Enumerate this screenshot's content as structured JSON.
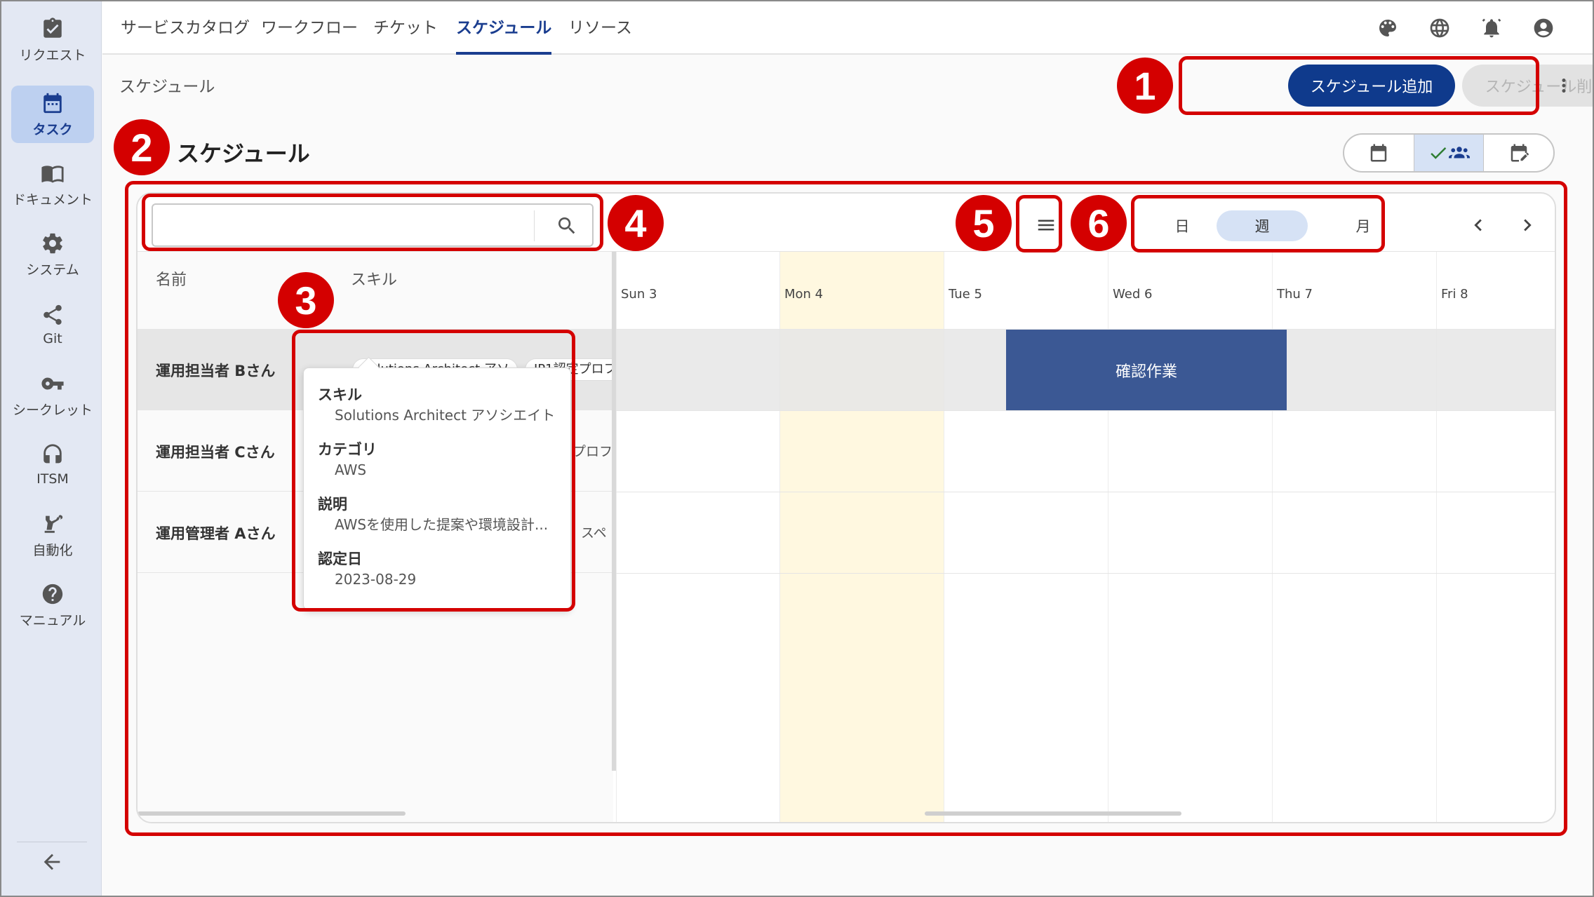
{
  "sidebar": {
    "items": [
      {
        "label": "リクエスト",
        "icon": "clipboard-check-icon"
      },
      {
        "label": "タスク",
        "icon": "calendar-icon"
      },
      {
        "label": "ドキュメント",
        "icon": "book-icon"
      },
      {
        "label": "システム",
        "icon": "gear-icon"
      },
      {
        "label": "Git",
        "icon": "share-icon"
      },
      {
        "label": "シークレット",
        "icon": "key-icon"
      },
      {
        "label": "ITSM",
        "icon": "headset-icon"
      },
      {
        "label": "自動化",
        "icon": "robot-arm-icon"
      },
      {
        "label": "マニュアル",
        "icon": "help-icon"
      }
    ],
    "active_index": 1,
    "collapse_icon": "arrow-left-icon"
  },
  "topnav": {
    "tabs": [
      "サービスカタログ",
      "ワークフロー",
      "チケット",
      "スケジュール",
      "リソース"
    ],
    "active_tab": "スケジュール",
    "icons": [
      "palette-icon",
      "globe-icon",
      "bell-icon",
      "account-icon"
    ]
  },
  "subheader": {
    "breadcrumb": "スケジュール",
    "add_button": "スケジュール追加",
    "delete_button": "スケジュール削除"
  },
  "section": {
    "title": "スケジュール"
  },
  "toolbar": {
    "search_placeholder": "",
    "range_options": [
      "日",
      "週",
      "月"
    ],
    "selected_range": "週"
  },
  "grid": {
    "columns": [
      "名前",
      "スキル"
    ],
    "rows": [
      {
        "name": "運用担当者 Bさん",
        "chips": [
          "Solutions Architect アソ...",
          "JP1認定プロフ"
        ]
      },
      {
        "name": "運用担当者 Cさん",
        "chips_peek": "プロフ"
      },
      {
        "name": "運用管理者 Aさん",
        "chips_peek": "スペ"
      }
    ]
  },
  "tooltip": {
    "skill_label": "スキル",
    "skill_value": "Solutions Architect アソシエイト",
    "category_label": "カテゴリ",
    "category_value": "AWS",
    "desc_label": "説明",
    "desc_value": "AWSを使用した提案や環境設計...",
    "date_label": "認定日",
    "date_value": "2023-08-29"
  },
  "calendar": {
    "days": [
      "Sun 3",
      "Mon 4",
      "Tue 5",
      "Wed 6",
      "Thu 7",
      "Fri 8"
    ],
    "today": "Mon 4",
    "events": [
      {
        "row": 0,
        "label": "確認作業",
        "start": "Wed 6",
        "color": "#3b5894"
      }
    ]
  },
  "callouts": [
    "1",
    "2",
    "3",
    "4",
    "5",
    "6"
  ],
  "colors": {
    "accent": "#0f3a8c",
    "callout": "#d40000",
    "today": "#fff8e0"
  }
}
